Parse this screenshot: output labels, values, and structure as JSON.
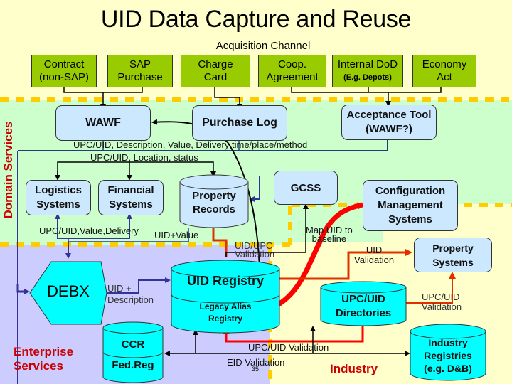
{
  "title": "UID Data Capture and Reuse",
  "acquisition": {
    "label": "Acquisition Channel",
    "boxes": [
      {
        "line1": "Contract",
        "line2": "(non-SAP)"
      },
      {
        "line1": "SAP",
        "line2": "Purchase"
      },
      {
        "line1": "Charge",
        "line2": "Card"
      },
      {
        "line1": "Coop.",
        "line2": "Agreement"
      },
      {
        "line1": "Internal DoD",
        "line2": "(E.g. Depots)"
      },
      {
        "line1": "Economy",
        "line2": "Act"
      }
    ]
  },
  "regions": {
    "domain_services": "Domain Services",
    "enterprise_services_line1": "Enterprise",
    "enterprise_services_line2": "Services",
    "industry": "Industry"
  },
  "domain": {
    "wawf": "WAWF",
    "purchase_log": "Purchase Log",
    "acceptance_tool_line1": "Acceptance Tool",
    "acceptance_tool_line2": "(WAWF?)",
    "flow_label_1": "UPC/UID, Description, Value, Delivery time/place/method",
    "flow_label_2": "UPC/UID, Location, status",
    "logistics_line1": "Logistics",
    "logistics_line2": "Systems",
    "financial_line1": "Financial",
    "financial_line2": "Systems",
    "property_records_line1": "Property",
    "property_records_line2": "Records",
    "gcss": "GCSS",
    "config_mgmt_line1": "Configuration",
    "config_mgmt_line2": "Management",
    "config_mgmt_line3": "Systems",
    "value_delivery_label": "UPC/UID,Value,Delivery",
    "uid_value_label": "UID+Value",
    "map_uid_line1": "Map UID to",
    "map_uid_line2": "baseline"
  },
  "enterprise": {
    "debx": "DEBX",
    "uid_desc_line1": "UID +",
    "uid_desc_line2": "Description",
    "uid_registry": "UID Registry",
    "legacy_line1": "Legacy Alias",
    "legacy_line2": "Registry",
    "ccr": "CCR",
    "fedreg": "Fed.Reg",
    "uid_upc_val_line1": "UID/UPC",
    "uid_upc_val_line2": "Validation",
    "upc_uid_validation": "UPC/UID Validation",
    "eid_validation": "EID Validation",
    "page_number": "35"
  },
  "industry": {
    "uid_val_line1": "UID",
    "uid_val_line2": "Validation",
    "property_systems_line1": "Property",
    "property_systems_line2": "Systems",
    "upc_dir_line1": "UPC/UID",
    "upc_dir_line2": "Directories",
    "upc_val_line1": "UPC/UID",
    "upc_val_line2": "Validation",
    "industry_reg_line1": "Industry",
    "industry_reg_line2": "Registries",
    "industry_reg_line3": "(e.g. D&B)"
  },
  "colors": {
    "background_acquisition": "#ffffcc",
    "background_domain": "#ccffcc",
    "background_enterprise": "#ccccff",
    "green_box": "#99cc00",
    "blue_box": "#cce8ff",
    "cyan_cylinder": "#00ffff",
    "dashed_divider": "#ffcc00",
    "red_label": "#cc0000"
  }
}
